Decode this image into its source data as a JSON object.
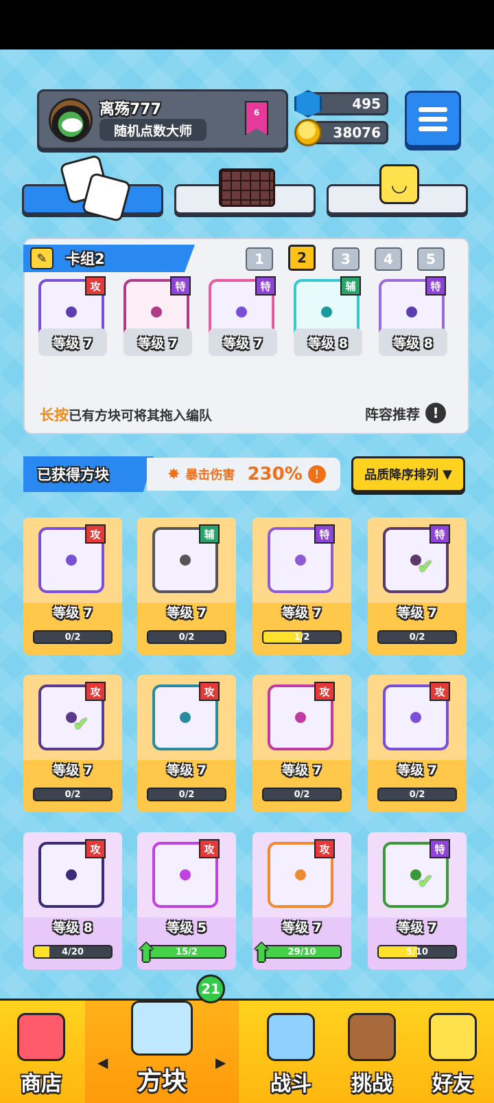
{
  "player": {
    "name": "离殇777",
    "title": "随机点数大师",
    "rank": "6",
    "gems": "495",
    "coins": "38076"
  },
  "deck": {
    "name": "卡组2",
    "slots": [
      "1",
      "2",
      "3",
      "4",
      "5"
    ],
    "active_slot": "2",
    "cards": [
      {
        "tag": "攻",
        "level": "等级 7",
        "color": "#7a4fd8"
      },
      {
        "tag": "特",
        "level": "等级 7",
        "color": "#b03a8a"
      },
      {
        "tag": "特",
        "level": "等级 7",
        "color": "#e85aa0"
      },
      {
        "tag": "辅",
        "level": "等级 8",
        "color": "#35c9d0"
      },
      {
        "tag": "特",
        "level": "等级 8",
        "color": "#9a6ad8"
      }
    ],
    "hint_key": "长按",
    "hint_text": "已有方块可将其拖入编队",
    "recommend": "阵容推荐"
  },
  "owned": {
    "label": "已获得方块",
    "crit_label": "暴击伤害",
    "crit_value": "230%",
    "sort_label": "品质降序排列",
    "cards": [
      {
        "tag": "攻",
        "level": "等级 7",
        "progress": "0/2",
        "fill": 0,
        "bar": "yellow"
      },
      {
        "tag": "辅",
        "level": "等级 7",
        "progress": "0/2",
        "fill": 0,
        "bar": "yellow"
      },
      {
        "tag": "特",
        "level": "等级 7",
        "progress": "1/2",
        "fill": 0.5,
        "bar": "yellow"
      },
      {
        "tag": "特",
        "level": "等级 7",
        "progress": "0/2",
        "fill": 0,
        "bar": "yellow"
      },
      {
        "tag": "攻",
        "level": "等级 7",
        "progress": "0/2",
        "fill": 0,
        "bar": "yellow"
      },
      {
        "tag": "攻",
        "level": "等级 7",
        "progress": "0/2",
        "fill": 0,
        "bar": "yellow"
      },
      {
        "tag": "攻",
        "level": "等级 7",
        "progress": "0/2",
        "fill": 0,
        "bar": "yellow"
      },
      {
        "tag": "攻",
        "level": "等级 7",
        "progress": "0/2",
        "fill": 0,
        "bar": "yellow"
      },
      {
        "tag": "攻",
        "level": "等级 8",
        "progress": "4/20",
        "fill": 0.2,
        "bar": "yellow"
      },
      {
        "tag": "攻",
        "level": "等级 5",
        "progress": "15/2",
        "fill": 1,
        "bar": "green"
      },
      {
        "tag": "攻",
        "level": "等级 7",
        "progress": "29/10",
        "fill": 1,
        "bar": "green"
      },
      {
        "tag": "特",
        "level": "等级 7",
        "progress": "5/10",
        "fill": 0.5,
        "bar": "yellow"
      }
    ]
  },
  "nav": {
    "shop": "商店",
    "blocks": "方块",
    "battle": "战斗",
    "challenge": "挑战",
    "friends": "好友",
    "blocks_badge": "21"
  }
}
